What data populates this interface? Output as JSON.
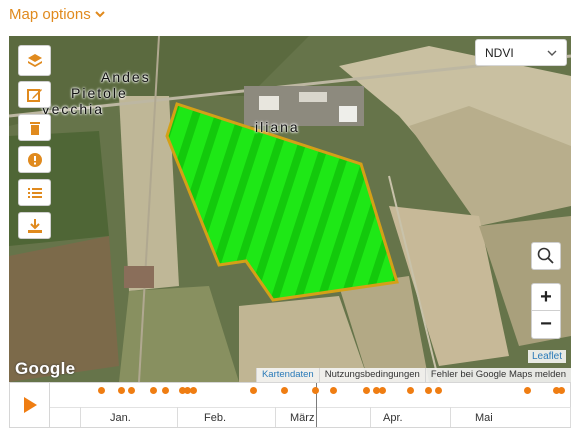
{
  "header": {
    "map_options_label": "Map options"
  },
  "map": {
    "layer_select": {
      "value": "NDVI"
    },
    "labels": [
      "Andes",
      "Pietole",
      "Vecchia",
      "iliana"
    ],
    "side_tools": [
      {
        "icon": "layers-icon",
        "color": "#e08a1e"
      },
      {
        "icon": "edit-icon",
        "color": "#e08a1e"
      },
      {
        "icon": "trash-icon",
        "color": "#e08a1e"
      },
      {
        "icon": "info-icon",
        "color": "#e08a1e"
      },
      {
        "icon": "list-icon",
        "color": "#e08a1e"
      },
      {
        "icon": "download-icon",
        "color": "#e08a1e"
      }
    ],
    "zoom_in_label": "+",
    "zoom_out_label": "−",
    "attribution": {
      "leaflet": "Leaflet",
      "map_data": "Kartendaten",
      "terms": "Nutzungsbedingungen",
      "report": "Fehler bei Google Maps melden",
      "google": "Google"
    },
    "field_color": "#19e00f",
    "field_outline": "#d4a017"
  },
  "timeline": {
    "months": [
      "Jan.",
      "Feb.",
      "März",
      "Apr.",
      "Mai"
    ],
    "dot_color": "#ef7d12"
  }
}
